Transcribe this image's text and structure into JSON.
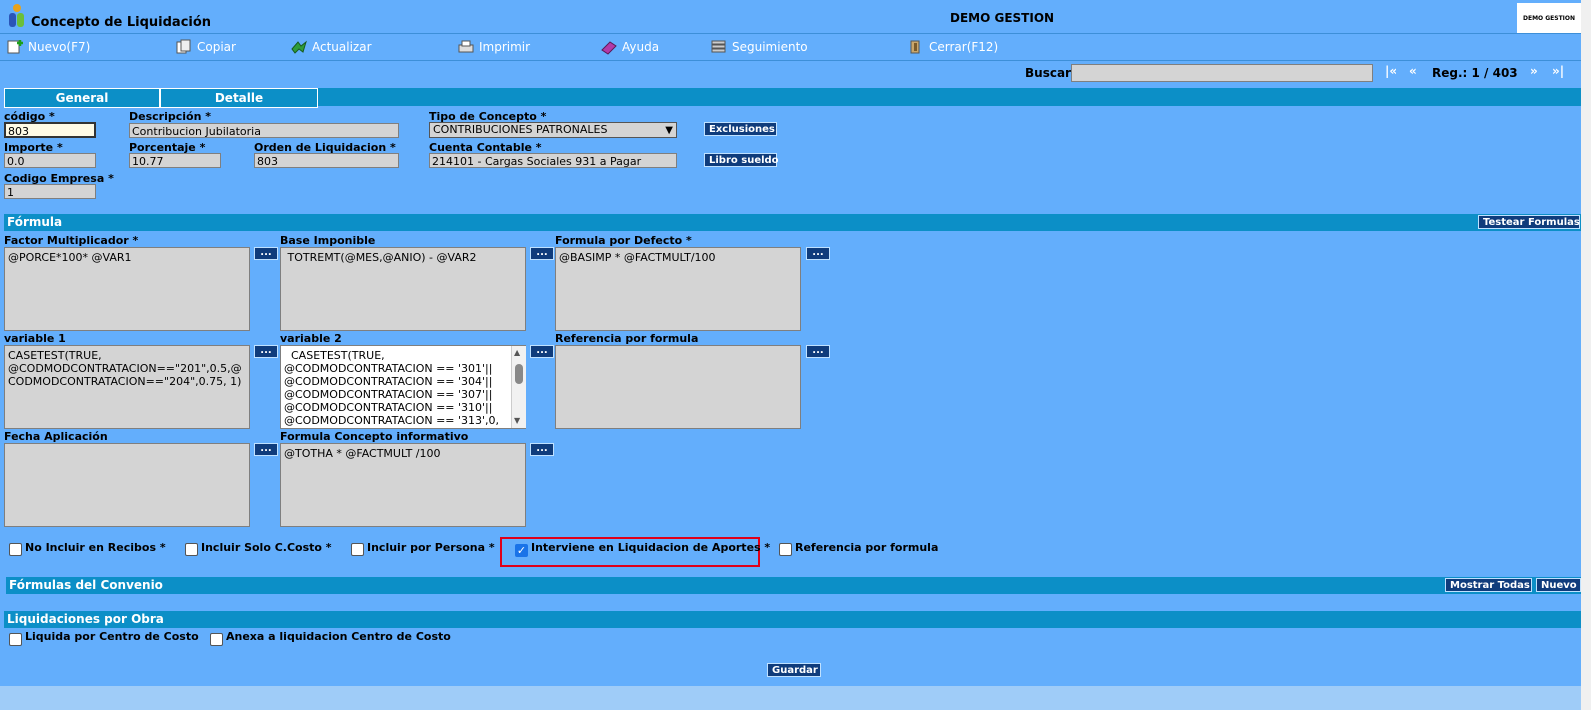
{
  "window": {
    "title": "Concepto de Liquidación",
    "app_name": "DEMO GESTION",
    "brand": "DEMO GESTION"
  },
  "toolbar": [
    {
      "label": "Nuevo(F7)",
      "icon": "new-icon"
    },
    {
      "label": "Copiar",
      "icon": "copy-icon"
    },
    {
      "label": "Actualizar",
      "icon": "refresh-icon"
    },
    {
      "label": "Imprimir",
      "icon": "print-icon"
    },
    {
      "label": "Ayuda",
      "icon": "help-icon"
    },
    {
      "label": "Seguimiento",
      "icon": "tracking-icon"
    },
    {
      "label": "Cerrar(F12)",
      "icon": "close-icon"
    }
  ],
  "search": {
    "label": "Buscar",
    "value": ""
  },
  "nav": {
    "first": "|«",
    "prev": "«",
    "record": "Reg.: 1 / 403",
    "next": "»",
    "last": "»|"
  },
  "tabs": [
    "General",
    "Detalle"
  ],
  "fields": {
    "codigo": {
      "label": "código *",
      "value": "803"
    },
    "descripcion": {
      "label": "Descripción *",
      "value": "Contribucion Jubilatoria"
    },
    "tipo": {
      "label": "Tipo de Concepto *",
      "value": "CONTRIBUCIONES PATRONALES"
    },
    "importe": {
      "label": "Importe *",
      "value": "0.0"
    },
    "porcentaje": {
      "label": "Porcentaje *",
      "value": "10.77"
    },
    "orden": {
      "label": "Orden de Liquidacion *",
      "value": "803"
    },
    "cuenta": {
      "label": "Cuenta Contable *",
      "value": "214101 - Cargas Sociales 931 a Pagar"
    },
    "empresa": {
      "label": "Codigo Empresa *",
      "value": "1"
    }
  },
  "buttons": {
    "exclusiones": "Exclusiones",
    "libro": "Libro sueldo",
    "testear": "Testear Formulas",
    "mostrar": "Mostrar Todas",
    "nuevo": "Nuevo",
    "guardar": "Guardar",
    "dots": "..."
  },
  "sections": {
    "formula": "Fórmula",
    "convenio": "Fórmulas del Convenio",
    "obra": "Liquidaciones por Obra"
  },
  "formulas": {
    "factor": {
      "label": "Factor Multiplicador *",
      "value": "@PORCE*100* @VAR1"
    },
    "base": {
      "label": "Base Imponible",
      "value": " TOTREMT(@MES,@ANIO) - @VAR2"
    },
    "defecto": {
      "label": "Formula por Defecto *",
      "value": "@BASIMP * @FACTMULT/100"
    },
    "var1": {
      "label": "variable 1",
      "value": "CASETEST(TRUE,\n@CODMODCONTRATACION==\"201\",0.5,@\nCODMODCONTRATACION==\"204\",0.75, 1)"
    },
    "var2": {
      "label": "variable 2",
      "value": "  CASETEST(TRUE,\n@CODMODCONTRATACION == '301'||\n@CODMODCONTRATACION == '304'||\n@CODMODCONTRATACION == '307'||\n@CODMODCONTRATACION == '310'||\n@CODMODCONTRATACION == '313',0,"
    },
    "referencia": {
      "label": "Referencia por formula",
      "value": ""
    },
    "fecha": {
      "label": "Fecha Aplicación",
      "value": ""
    },
    "informativo": {
      "label": "Formula Concepto informativo",
      "value": "@TOTHA * @FACTMULT /100"
    }
  },
  "checkboxes": [
    {
      "label": "No Incluir en Recibos *",
      "checked": false
    },
    {
      "label": "Incluir Solo C.Costo *",
      "checked": false
    },
    {
      "label": "Incluir por Persona *",
      "checked": false
    },
    {
      "label": "Interviene en Liquidacion de Aportes *",
      "checked": true
    },
    {
      "label": "Referencia por formula",
      "checked": false
    }
  ],
  "obra_checkboxes": [
    {
      "label": "Liquida por Centro de Costo",
      "checked": false
    },
    {
      "label": "Anexa a liquidacion Centro de Costo",
      "checked": false
    }
  ]
}
